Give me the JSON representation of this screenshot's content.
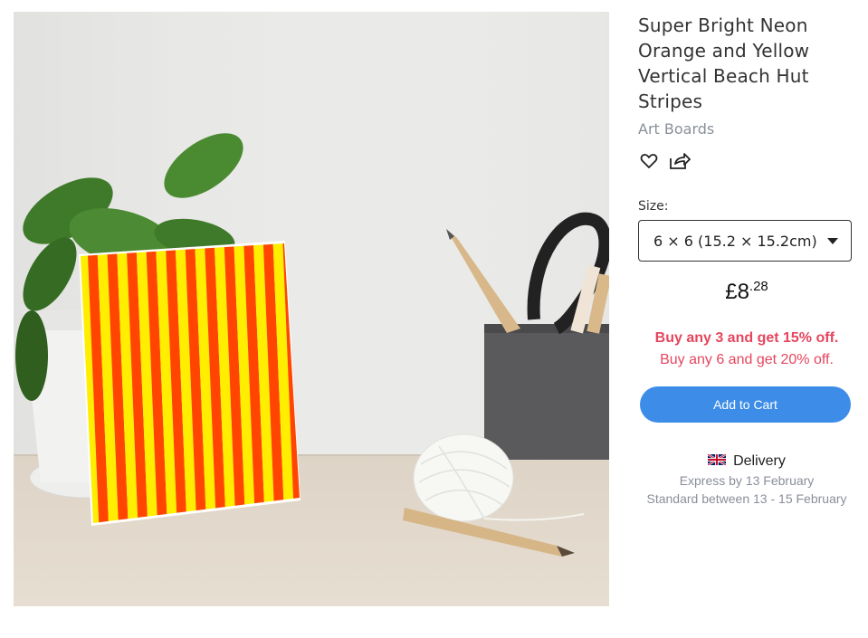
{
  "product": {
    "title": "Super Bright Neon Orange and Yellow Vertical Beach Hut Stripes",
    "category": "Art Boards"
  },
  "actions": {
    "favorite_icon": "heart-icon",
    "share_icon": "share-icon"
  },
  "size": {
    "label": "Size:",
    "selected": "6 × 6 (15.2 × 15.2cm)"
  },
  "price": {
    "main": "£8",
    "cents": ".28"
  },
  "promo": {
    "line1": "Buy any 3 and get 15% off.",
    "line2": "Buy any 6 and get 20% off."
  },
  "cart": {
    "label": "Add to Cart"
  },
  "delivery": {
    "title": "Delivery",
    "flag": "uk-flag-icon",
    "express": "Express by 13 February",
    "standard": "Standard between 13 - 15 February"
  },
  "colors": {
    "stripe_orange": "#ff4500",
    "stripe_yellow": "#ffee00",
    "accent_blue": "#3d8de8",
    "promo_red": "#e5465e"
  }
}
